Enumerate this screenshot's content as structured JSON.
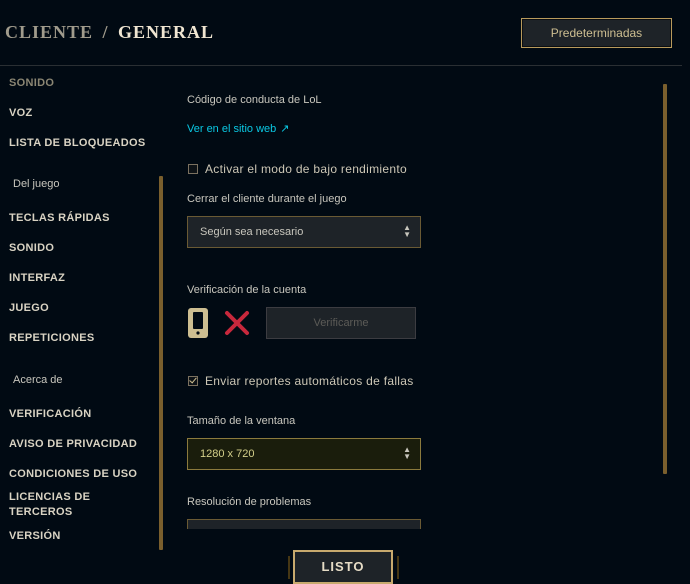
{
  "header": {
    "breadcrumb_parent": "CLIENTE",
    "breadcrumb_separator": "/",
    "breadcrumb_current": "GENERAL",
    "defaults_button": "Predeterminadas"
  },
  "sidebar": {
    "items_top": [
      {
        "label": "SONIDO"
      },
      {
        "label": "VOZ"
      },
      {
        "label": "LISTA DE BLOQUEADOS"
      }
    ],
    "section_game": "Del juego",
    "items_game": [
      {
        "label": "TECLAS RÁPIDAS"
      },
      {
        "label": "SONIDO"
      },
      {
        "label": "INTERFAZ"
      },
      {
        "label": "JUEGO"
      },
      {
        "label": "REPETICIONES"
      }
    ],
    "section_about": "Acerca de",
    "items_about": [
      {
        "label": "VERIFICACIÓN"
      },
      {
        "label": "AVISO DE PRIVACIDAD"
      },
      {
        "label": "CONDICIONES DE USO"
      },
      {
        "label": "LICENCIAS DE TERCEROS"
      },
      {
        "label": "VERSIÓN"
      }
    ]
  },
  "main": {
    "code_of_conduct_label": "Código de conducta de LoL",
    "code_of_conduct_link": "Ver en el sitio web",
    "link_arrow": "↗",
    "low_spec_mode": {
      "label": "Activar el modo de bajo rendimiento",
      "checked": false
    },
    "close_client_label": "Cerrar el cliente durante el juego",
    "close_client_value": "Según sea necesario",
    "account_verification_label": "Verificación de la cuenta",
    "verify_button": "Verificarme",
    "crash_reports": {
      "label": "Enviar reportes automáticos de fallas",
      "checked": true
    },
    "window_size_label": "Tamaño de la ventana",
    "window_size_value": "1280 x 720",
    "troubleshooting_label": "Resolución de problemas"
  },
  "footer": {
    "done_button": "LISTO"
  },
  "colors": {
    "background": "#010a13",
    "gold": "#c8aa6e",
    "link": "#0ac8e3",
    "error": "#c8283c"
  },
  "icons": [
    "phone-icon",
    "x-mark-icon",
    "external-link-icon",
    "chevron-up-down-icon",
    "checkmark-icon"
  ]
}
